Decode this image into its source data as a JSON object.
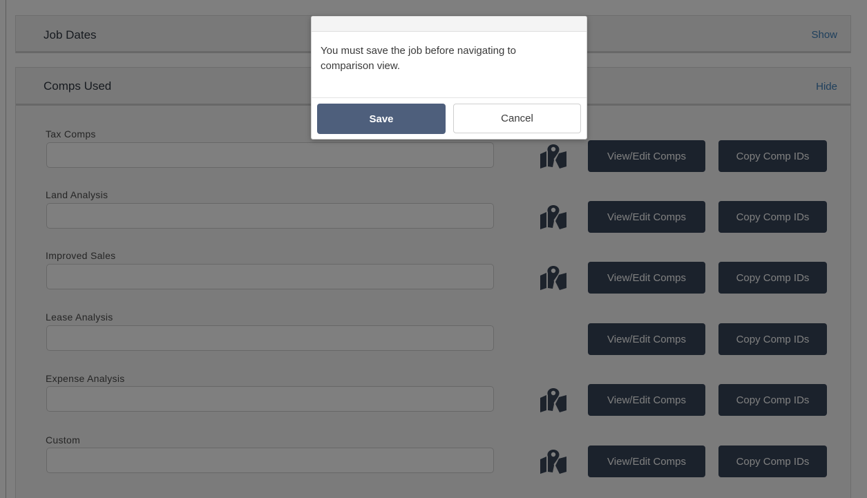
{
  "panels": {
    "job_dates": {
      "title": "Job Dates",
      "toggle": "Show"
    },
    "comps_used": {
      "title": "Comps Used",
      "toggle": "Hide"
    }
  },
  "rows": [
    {
      "label": "Tax Comps",
      "value": "",
      "has_map_icon": true,
      "view_label": "View/Edit Comps",
      "copy_label": "Copy Comp IDs"
    },
    {
      "label": "Land Analysis",
      "value": "",
      "has_map_icon": true,
      "view_label": "View/Edit Comps",
      "copy_label": "Copy Comp IDs"
    },
    {
      "label": "Improved Sales",
      "value": "",
      "has_map_icon": true,
      "view_label": "View/Edit Comps",
      "copy_label": "Copy Comp IDs"
    },
    {
      "label": "Lease Analysis",
      "value": "",
      "has_map_icon": false,
      "view_label": "View/Edit Comps",
      "copy_label": "Copy Comp IDs"
    },
    {
      "label": "Expense Analysis",
      "value": "",
      "has_map_icon": true,
      "view_label": "View/Edit Comps",
      "copy_label": "Copy Comp IDs"
    },
    {
      "label": "Custom",
      "value": "",
      "has_map_icon": true,
      "view_label": "View/Edit Comps",
      "copy_label": "Copy Comp IDs"
    }
  ],
  "icons": {
    "map": "map-marker-icon"
  },
  "modal": {
    "message": "You must save the job before navigating to comparison view.",
    "save_label": "Save",
    "cancel_label": "Cancel"
  },
  "colors": {
    "dark_button": "#364559",
    "save_button": "#4e5f7c",
    "link": "#3d7eb8"
  }
}
